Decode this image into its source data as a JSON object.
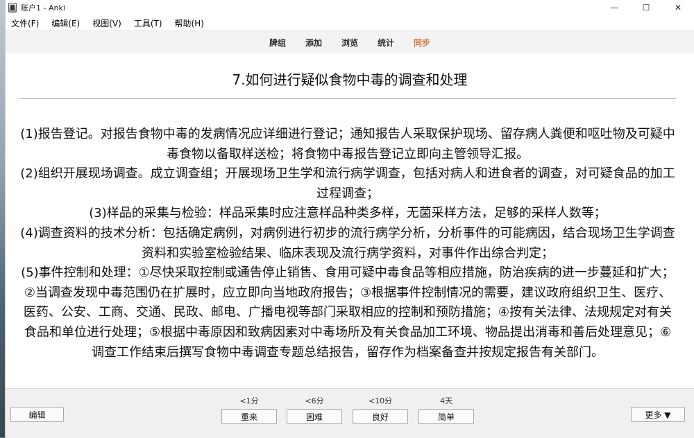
{
  "window": {
    "title": "账户1 - Anki",
    "controls": [
      "—",
      "☐",
      "✕"
    ]
  },
  "menu": [
    "文件(F)",
    "编辑(E)",
    "视图(V)",
    "工具(T)",
    "帮助(H)"
  ],
  "toolbar": {
    "items": [
      "牌组",
      "添加",
      "浏览",
      "统计",
      "同步"
    ],
    "active_index": 4,
    "active_color": "#d9733a"
  },
  "card": {
    "question": "7.如何进行疑似食物中毒的调查和处理",
    "answer_paragraphs": [
      "(1)报告登记。对报告食物中毒的发病情况应详细进行登记；通知报告人采取保护现场、留存病人粪便和呕吐物及可疑中毒食物以备取样送检；将食物中毒报告登记立即向主管领导汇报。",
      "(2)组织开展现场调查。成立调查组；开展现场卫生学和流行病学调查，包括对病人和进食者的调查，对可疑食品的加工过程调查；",
      "(3)样品的采集与检验：样品采集时应注意样品种类多样，无菌采样方法，足够的采样人数等；",
      "(4)调查资料的技术分析：包括确定病例，对病例进行初步的流行病学分析，分析事件的可能病因，结合现场卫生学调查资料和实验室检验结果、临床表现及流行病学资料，对事件作出综合判定；",
      "(5)事件控制和处理：①尽快采取控制或通告停止销售、食用可疑中毒食品等相应措施，防治疾病的进一步蔓延和扩大； ②当调查发现中毒范围仍在扩展时，应立即向当地政府报告；③根据事件控制情况的需要，建议政府组织卫生、医疗、医药、公安、工商、交通、民政、邮电、广播电视等部门采取相应的控制和预防措施；④按有关法律、法规规定对有关食品和单位进行处理；⑤根据中毒原因和致病因素对中毒场所及有关食品加工环境、物品提出消毒和善后处理意见；⑥调查工作结束后撰写食物中毒调查专题总结报告，留存作为档案备查并按规定报告有关部门。"
    ]
  },
  "bottom": {
    "edit_label": "编辑",
    "more_label": "更多 ▼",
    "ease": [
      {
        "time": "<1分",
        "label": "重来"
      },
      {
        "time": "<6分",
        "label": "困难"
      },
      {
        "time": "<10分",
        "label": "良好"
      },
      {
        "time": "4天",
        "label": "简单"
      }
    ]
  }
}
